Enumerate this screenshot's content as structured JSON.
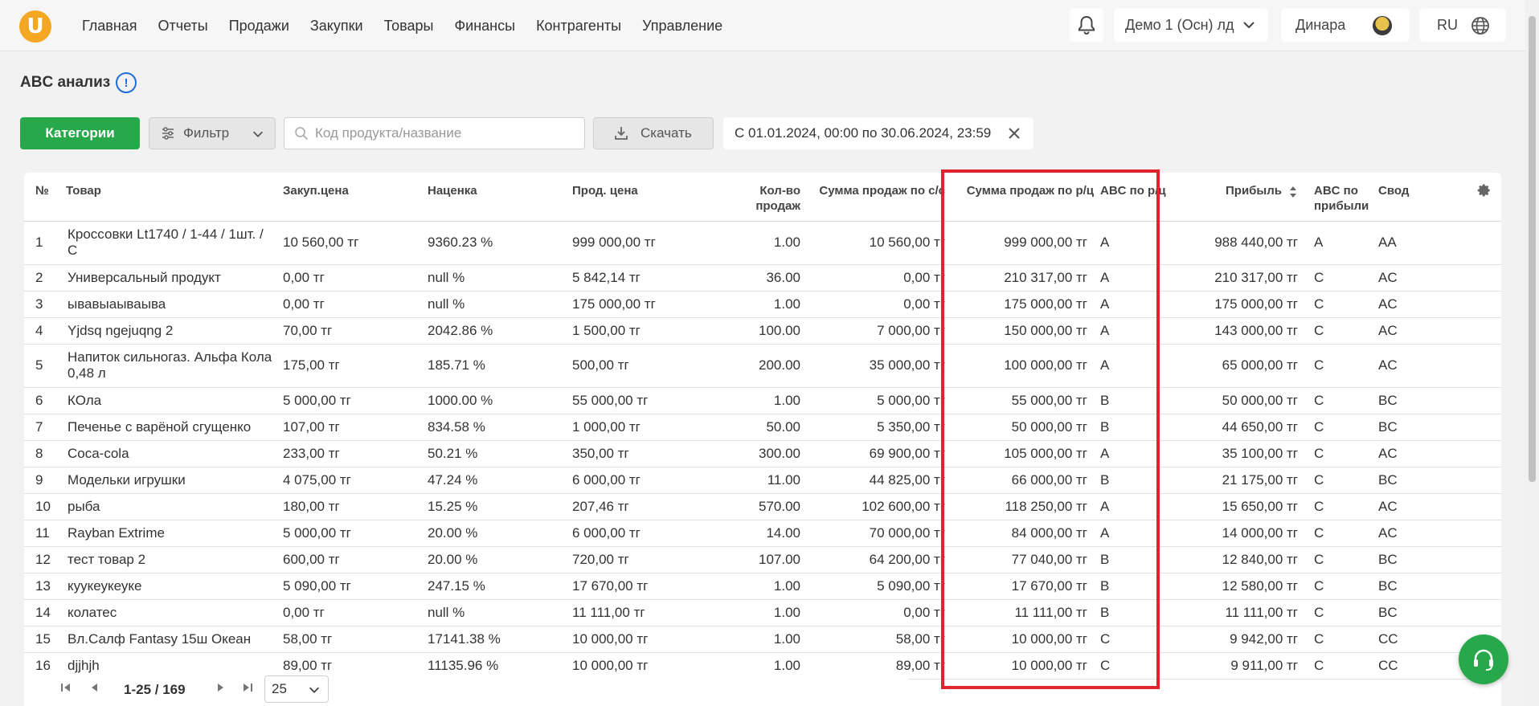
{
  "header": {
    "logo_letter": "U",
    "nav": [
      "Главная",
      "Отчеты",
      "Продажи",
      "Закупки",
      "Товары",
      "Финансы",
      "Контрагенты",
      "Управление"
    ],
    "account": "Демо 1 (Осн) лд",
    "user": "Динара",
    "lang": "RU"
  },
  "page": {
    "title": "ABC анализ",
    "info_icon": "!"
  },
  "toolbar": {
    "categories_label": "Категории",
    "filter_label": "Фильтр",
    "search_placeholder": "Код продукта/название",
    "download_label": "Скачать",
    "date_range": "С 01.01.2024, 00:00 по 30.06.2024, 23:59"
  },
  "table": {
    "columns": {
      "num": "№",
      "product": "Товар",
      "purchase_price": "Закуп.цена",
      "markup": "Наценка",
      "sale_price": "Прод. цена",
      "qty": "Кол-во продаж",
      "sum_cost": "Сумма продаж по с/с",
      "sum_retail": "Сумма продаж по р/ц",
      "abc_retail": "ABC по р/ц",
      "profit": "Прибыль",
      "abc_profit": "ABC по прибыли",
      "summary": "Свод"
    },
    "rows": [
      {
        "n": "1",
        "product": "Кроссовки Lt1740 / 1-44 / 1шт. / С",
        "purchase": "10 560,00 тг",
        "markup": "9360.23 %",
        "sale": "999 000,00 тг",
        "qty": "1.00",
        "sum_cost": "10 560,00 тг",
        "sum_retail": "999 000,00 тг",
        "abc_retail": "A",
        "profit": "988 440,00 тг",
        "abc_profit": "A",
        "summary": "AA"
      },
      {
        "n": "2",
        "product": "Универсальный продукт",
        "purchase": "0,00 тг",
        "markup": "null %",
        "sale": "5 842,14 тг",
        "qty": "36.00",
        "sum_cost": "0,00 тг",
        "sum_retail": "210 317,00 тг",
        "abc_retail": "A",
        "profit": "210 317,00 тг",
        "abc_profit": "C",
        "summary": "AC"
      },
      {
        "n": "3",
        "product": "ывавыаываыва",
        "purchase": "0,00 тг",
        "markup": "null %",
        "sale": "175 000,00 тг",
        "qty": "1.00",
        "sum_cost": "0,00 тг",
        "sum_retail": "175 000,00 тг",
        "abc_retail": "A",
        "profit": "175 000,00 тг",
        "abc_profit": "C",
        "summary": "AC"
      },
      {
        "n": "4",
        "product": "Yjdsq ngejuqng 2",
        "purchase": "70,00 тг",
        "markup": "2042.86 %",
        "sale": "1 500,00 тг",
        "qty": "100.00",
        "sum_cost": "7 000,00 тг",
        "sum_retail": "150 000,00 тг",
        "abc_retail": "A",
        "profit": "143 000,00 тг",
        "abc_profit": "C",
        "summary": "AC"
      },
      {
        "n": "5",
        "product": "Напиток сильногаз. Альфа Кола 0,48 л",
        "purchase": "175,00 тг",
        "markup": "185.71 %",
        "sale": "500,00 тг",
        "qty": "200.00",
        "sum_cost": "35 000,00 тг",
        "sum_retail": "100 000,00 тг",
        "abc_retail": "A",
        "profit": "65 000,00 тг",
        "abc_profit": "C",
        "summary": "AC"
      },
      {
        "n": "6",
        "product": "КОла",
        "purchase": "5 000,00 тг",
        "markup": "1000.00 %",
        "sale": "55 000,00 тг",
        "qty": "1.00",
        "sum_cost": "5 000,00 тг",
        "sum_retail": "55 000,00 тг",
        "abc_retail": "B",
        "profit": "50 000,00 тг",
        "abc_profit": "C",
        "summary": "BC"
      },
      {
        "n": "7",
        "product": "Печенье с варёной сгущенко",
        "purchase": "107,00 тг",
        "markup": "834.58 %",
        "sale": "1 000,00 тг",
        "qty": "50.00",
        "sum_cost": "5 350,00 тг",
        "sum_retail": "50 000,00 тг",
        "abc_retail": "B",
        "profit": "44 650,00 тг",
        "abc_profit": "C",
        "summary": "BC"
      },
      {
        "n": "8",
        "product": "Coca-cola",
        "purchase": "233,00 тг",
        "markup": "50.21 %",
        "sale": "350,00 тг",
        "qty": "300.00",
        "sum_cost": "69 900,00 тг",
        "sum_retail": "105 000,00 тг",
        "abc_retail": "A",
        "profit": "35 100,00 тг",
        "abc_profit": "C",
        "summary": "AC"
      },
      {
        "n": "9",
        "product": "Модельки игрушки",
        "purchase": "4 075,00 тг",
        "markup": "47.24 %",
        "sale": "6 000,00 тг",
        "qty": "11.00",
        "sum_cost": "44 825,00 тг",
        "sum_retail": "66 000,00 тг",
        "abc_retail": "B",
        "profit": "21 175,00 тг",
        "abc_profit": "C",
        "summary": "BC"
      },
      {
        "n": "10",
        "product": "рыба",
        "purchase": "180,00 тг",
        "markup": "15.25 %",
        "sale": "207,46 тг",
        "qty": "570.00",
        "sum_cost": "102 600,00 тг",
        "sum_retail": "118 250,00 тг",
        "abc_retail": "A",
        "profit": "15 650,00 тг",
        "abc_profit": "C",
        "summary": "AC"
      },
      {
        "n": "11",
        "product": "Rayban Extrime",
        "purchase": "5 000,00 тг",
        "markup": "20.00 %",
        "sale": "6 000,00 тг",
        "qty": "14.00",
        "sum_cost": "70 000,00 тг",
        "sum_retail": "84 000,00 тг",
        "abc_retail": "A",
        "profit": "14 000,00 тг",
        "abc_profit": "C",
        "summary": "AC"
      },
      {
        "n": "12",
        "product": "тест товар 2",
        "purchase": "600,00 тг",
        "markup": "20.00 %",
        "sale": "720,00 тг",
        "qty": "107.00",
        "sum_cost": "64 200,00 тг",
        "sum_retail": "77 040,00 тг",
        "abc_retail": "B",
        "profit": "12 840,00 тг",
        "abc_profit": "C",
        "summary": "BC"
      },
      {
        "n": "13",
        "product": "куукеукеуке",
        "purchase": "5 090,00 тг",
        "markup": "247.15 %",
        "sale": "17 670,00 тг",
        "qty": "1.00",
        "sum_cost": "5 090,00 тг",
        "sum_retail": "17 670,00 тг",
        "abc_retail": "B",
        "profit": "12 580,00 тг",
        "abc_profit": "C",
        "summary": "BC"
      },
      {
        "n": "14",
        "product": "колатес",
        "purchase": "0,00 тг",
        "markup": "null %",
        "sale": "11 111,00 тг",
        "qty": "1.00",
        "sum_cost": "0,00 тг",
        "sum_retail": "11 111,00 тг",
        "abc_retail": "B",
        "profit": "11 111,00 тг",
        "abc_profit": "C",
        "summary": "BC"
      },
      {
        "n": "15",
        "product": "Вл.Салф Fantasy 15ш Океан",
        "purchase": "58,00 тг",
        "markup": "17141.38 %",
        "sale": "10 000,00 тг",
        "qty": "1.00",
        "sum_cost": "58,00 тг",
        "sum_retail": "10 000,00 тг",
        "abc_retail": "C",
        "profit": "9 942,00 тг",
        "abc_profit": "C",
        "summary": "CC"
      },
      {
        "n": "16",
        "product": "djjhjh",
        "purchase": "89,00 тг",
        "markup": "11135.96 %",
        "sale": "10 000,00 тг",
        "qty": "1.00",
        "sum_cost": "89,00 тг",
        "sum_retail": "10 000,00 тг",
        "abc_retail": "C",
        "profit": "9 911,00 тг",
        "abc_profit": "C",
        "summary": "CC"
      }
    ]
  },
  "pagination": {
    "range": "1-25 / 169",
    "page_size": "25"
  },
  "colors": {
    "accent_green": "#27a84a",
    "logo_orange": "#f5a623",
    "highlight_red": "#e0242e",
    "info_blue": "#1e6fd9"
  }
}
